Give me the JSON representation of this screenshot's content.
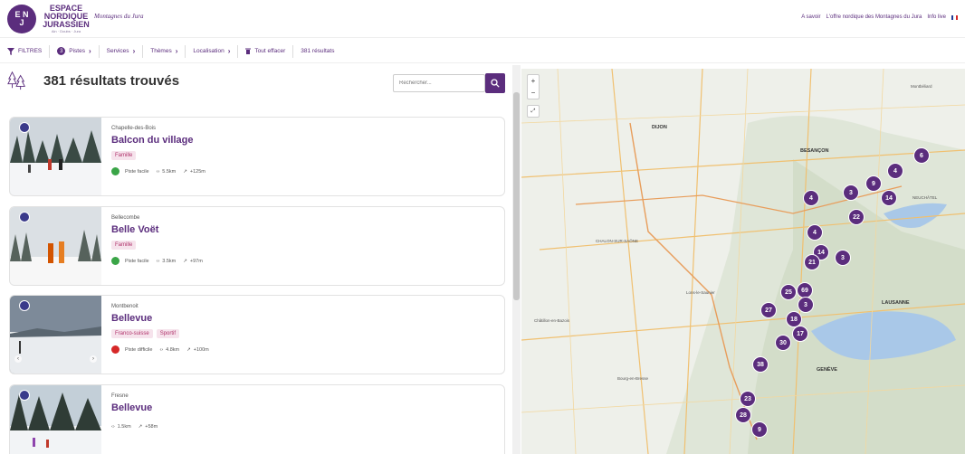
{
  "header": {
    "logo_initials": [
      "E N",
      "J"
    ],
    "logo_lines": [
      "ESPACE",
      "NORDIQUE",
      "JURASSIEN"
    ],
    "logo_tagline": "Ain · Doubs · Jura",
    "partner": "Montagnes du Jura",
    "links": [
      "A savoir",
      "L'offre nordique des Montagnes du Jura",
      "Info live"
    ],
    "flag_colors": [
      "#1f3a93",
      "#ffffff",
      "#d62828"
    ]
  },
  "filterbar": {
    "filtres": "FILTRES",
    "pistes_count": "3",
    "pistes": "Pistes",
    "services": "Services",
    "themes": "Thèmes",
    "localisation": "Localisation",
    "clear": "Tout effacer",
    "results_count": "381 résultats"
  },
  "results": {
    "title": "381 résultats trouvés",
    "search_placeholder": "Rechercher..."
  },
  "cards": [
    {
      "place": "Chapelle-des-Bois",
      "name": "Balcon du village",
      "tags": [
        "Famille"
      ],
      "difficulty": "Piste facile",
      "difficulty_color": "#3aa547",
      "distance": "5.5km",
      "elevation": "+125m"
    },
    {
      "place": "Bellecombe",
      "name": "Belle Voët",
      "tags": [
        "Famille"
      ],
      "difficulty": "Piste facile",
      "difficulty_color": "#3aa547",
      "distance": "3.5km",
      "elevation": "+97m"
    },
    {
      "place": "Montbenoit",
      "name": "Bellevue",
      "tags": [
        "Franco-suisse",
        "Sportif"
      ],
      "difficulty": "Piste difficile",
      "difficulty_color": "#d62828",
      "distance": "4.8km",
      "elevation": "+100m"
    },
    {
      "place": "Fresne",
      "name": "Bellevue",
      "tags": [],
      "difficulty": "",
      "difficulty_color": "",
      "distance": "1.5km",
      "elevation": "+58m"
    }
  ],
  "map": {
    "zoom_in": "+",
    "zoom_out": "−",
    "cities": [
      "DIJON",
      "BESANÇON",
      "LAUSANNE",
      "GENÈVE",
      "NEUCHÂTEL",
      "Lons-le-Saunier",
      "Montbéliard",
      "CHALON-SUR-SAÔNE",
      "Bourg-en-Bresse",
      "Châtillon-en-Bazois"
    ],
    "clusters": [
      "6",
      "4",
      "9",
      "3",
      "14",
      "4",
      "22",
      "4",
      "14",
      "21",
      "3",
      "25",
      "69",
      "3",
      "27",
      "18",
      "17",
      "30",
      "38",
      "23",
      "28",
      "9"
    ]
  }
}
